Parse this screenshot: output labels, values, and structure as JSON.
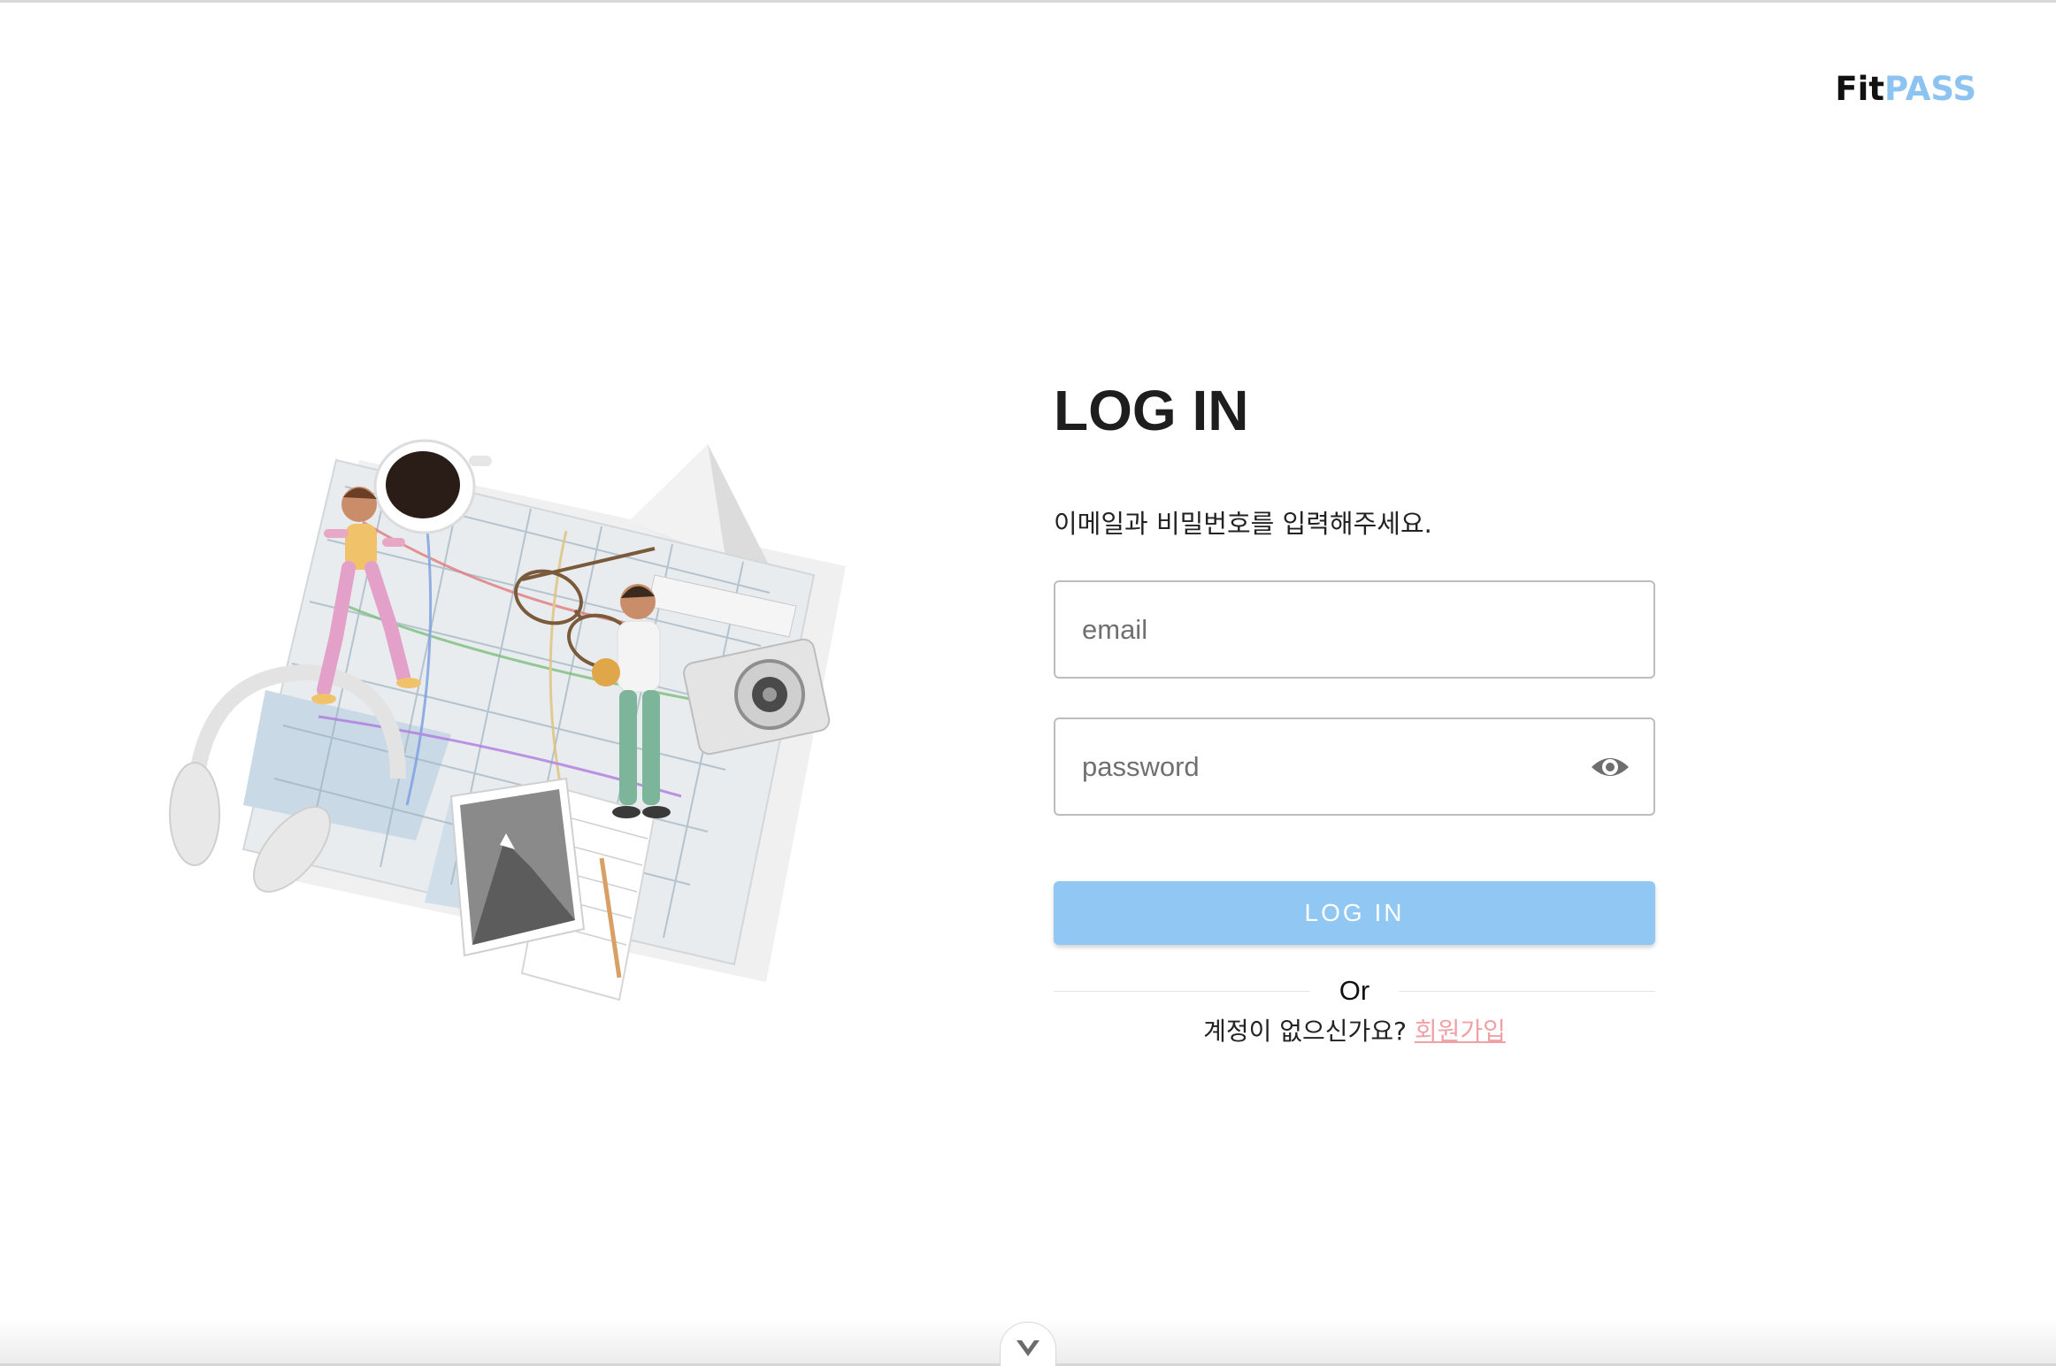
{
  "brand": {
    "logo_fit": "Fit",
    "logo_pass": "PASS",
    "accent_color": "#8cc3f1",
    "link_color": "#f1a0a6"
  },
  "login": {
    "title": "LOG IN",
    "subtitle": "이메일과 비밀번호를 입력해주세요.",
    "email_placeholder": "email",
    "password_placeholder": "password",
    "button_label": "LOG IN",
    "divider_text": "Or",
    "signup_prompt": "계정이 없으신가요?",
    "signup_link": "회원가입"
  },
  "icons": {
    "password_toggle": "eye-icon",
    "scroll_toggle": "chevron-down-icon"
  }
}
